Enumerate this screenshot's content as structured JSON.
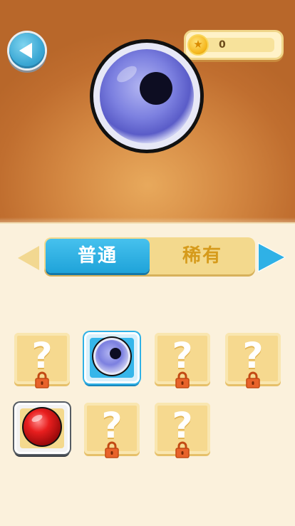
{
  "header": {
    "coin_count": "0",
    "coin_icon": "star-coin",
    "back_icon": "triangle-left"
  },
  "preview": {
    "selected_ball": "purple-eyeball"
  },
  "tabs": [
    {
      "label": "普通",
      "active": true
    },
    {
      "label": "稀有",
      "active": false
    }
  ],
  "grid": {
    "locked_symbol": "?",
    "slots": [
      {
        "state": "locked"
      },
      {
        "state": "unlocked",
        "ball": "purple-eyeball",
        "selected": true
      },
      {
        "state": "locked"
      },
      {
        "state": "locked"
      },
      {
        "state": "unlocked",
        "ball": "red-ball",
        "selected": false
      },
      {
        "state": "locked"
      },
      {
        "state": "locked"
      }
    ]
  },
  "colors": {
    "accent_blue": "#2fb1e6",
    "tab_inactive_text": "#d69b1c",
    "card_bg": "#f6d98f",
    "lock_orange": "#e8632a"
  }
}
